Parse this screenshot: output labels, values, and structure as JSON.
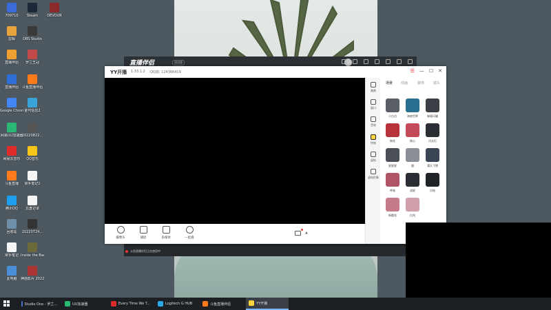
{
  "desktop": {
    "icons": [
      {
        "label": "709710",
        "color": "#3b6bd8"
      },
      {
        "label": "Steam",
        "color": "#1b2838"
      },
      {
        "label": "DEVOUR",
        "color": "#8b2a2a"
      },
      {
        "label": "剪辑",
        "color": "#e8a33c"
      },
      {
        "label": "OBS Studio",
        "color": "#3a3a3a"
      },
      {
        "label": "直播伴侣",
        "color": "#f0a030"
      },
      {
        "label": "罗兰王冠",
        "color": "#c34a4a"
      },
      {
        "label": "直播伴侣",
        "color": "#2d6fd6"
      },
      {
        "label": "斗鱼直播伴侣",
        "color": "#ff7a1a"
      },
      {
        "label": "Google Chrome",
        "color": "#4285f4"
      },
      {
        "label": "金可信息2",
        "color": "#3aa3d8"
      },
      {
        "label": "网易UU加速器",
        "color": "#2bb673"
      },
      {
        "label": "20220822...",
        "color": "#555"
      },
      {
        "label": "网易云音乐",
        "color": "#e02b2b"
      },
      {
        "label": "QQ音乐",
        "color": "#f5c518"
      },
      {
        "label": "斗鱼直播",
        "color": "#ff7a1a"
      },
      {
        "label": "常手笔记1",
        "color": "#f5f5f5"
      },
      {
        "label": "腾讯QQ",
        "color": "#1ea0f0"
      },
      {
        "label": "云盘记录",
        "color": "#f5f5f5"
      },
      {
        "label": "回收站",
        "color": "#6f8fa8"
      },
      {
        "label": "20220724...",
        "color": "#333"
      },
      {
        "label": "常手笔记",
        "color": "#f5f5f5"
      },
      {
        "label": "Inside the Backrooms",
        "color": "#6b6a3a"
      },
      {
        "label": "此电脑",
        "color": "#4a90d9"
      },
      {
        "label": "神庙影片 20220...",
        "color": "#a33"
      }
    ]
  },
  "bgwindow": {
    "logo": "直播伴侣",
    "version_badge": "测试版",
    "status_text": "斗鱼直播伴侣正在使用中"
  },
  "yy": {
    "brand_prefix": "YY",
    "brand_suffix": "开播",
    "version": "1.33.1.2",
    "qq": "QQ前: 124366419",
    "win_controls": {
      "menu": "☰",
      "minimize": "—",
      "maximize": "☐",
      "close": "✕"
    },
    "toolbar": [
      {
        "label": "摄像头",
        "shape": "round"
      },
      {
        "label": "捕捉",
        "shape": "square"
      },
      {
        "label": "多媒体",
        "shape": "square"
      },
      {
        "label": "一起看",
        "shape": "round"
      }
    ],
    "sidenav": [
      {
        "label": "美颜"
      },
      {
        "label": "窗口"
      },
      {
        "label": "音效"
      },
      {
        "label": "特效",
        "active": true
      },
      {
        "label": "虚拟"
      },
      {
        "label": "虚拟形象"
      }
    ],
    "tabs": [
      {
        "label": "场景",
        "active": true
      },
      {
        "label": "动画"
      },
      {
        "label": "装饰"
      },
      {
        "label": "镜头"
      }
    ],
    "effects": [
      {
        "label": "小白点",
        "color": "#5a5f66"
      },
      {
        "label": "海底世界",
        "color": "#2a6f8f"
      },
      {
        "label": "璀璨闪耀",
        "color": "#3a3f46"
      },
      {
        "label": "梅花",
        "color": "#b8323c"
      },
      {
        "label": "桃心",
        "color": "#c44a5a"
      },
      {
        "label": "闪光灯",
        "color": "#2b2f35"
      },
      {
        "label": "星星星",
        "color": "#4a4f56"
      },
      {
        "label": "猫",
        "color": "#8a8f96"
      },
      {
        "label": "满天飞雪",
        "color": "#3a4656"
      },
      {
        "label": "呼吸",
        "color": "#b05566"
      },
      {
        "label": "流星",
        "color": "#2a2d33"
      },
      {
        "label": "闪电",
        "color": "#1f2226"
      },
      {
        "label": "新樱花",
        "color": "#c57b8a"
      },
      {
        "label": "白兆",
        "color": "#d0a0aa"
      }
    ]
  },
  "taskbar": {
    "items": [
      {
        "label": "Studio One - 罗兰...",
        "color": "#4a6fd6",
        "active": false
      },
      {
        "label": "UU加速器",
        "color": "#2bb673",
        "active": false
      },
      {
        "label": "Every Time We T...",
        "color": "#e02b2b",
        "active": false
      },
      {
        "label": "Logitech G HUB",
        "color": "#2aa8e0",
        "active": false
      },
      {
        "label": "斗鱼直播伴侣",
        "color": "#ff7a1a",
        "active": false
      },
      {
        "label": "YY开播",
        "color": "#ffd43b",
        "active": true
      }
    ]
  }
}
